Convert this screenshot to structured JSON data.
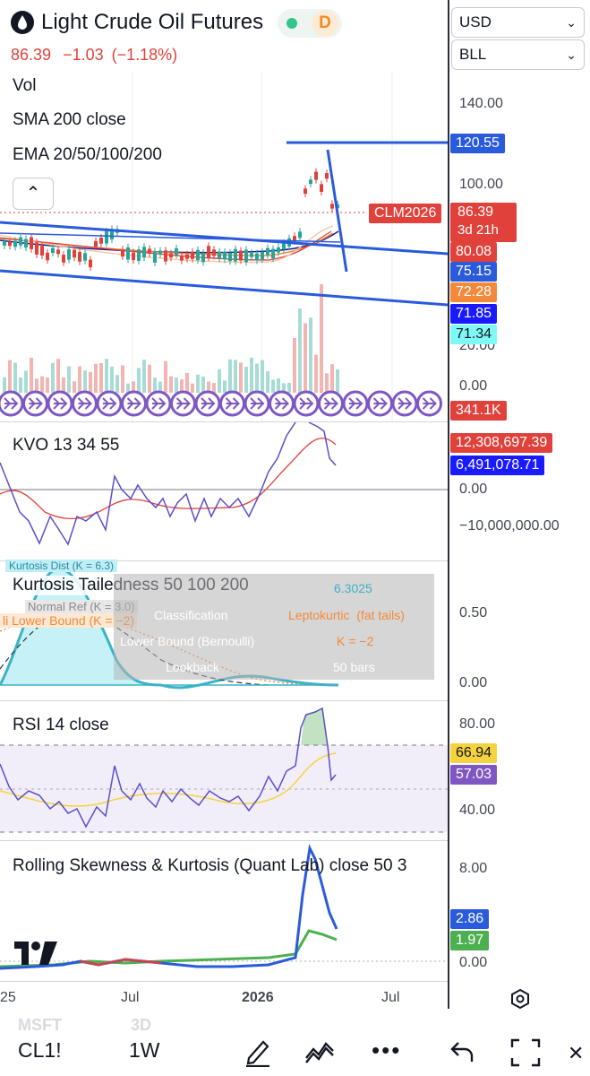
{
  "header": {
    "title": "Light Crude Oil Futures",
    "delay_badge": "D",
    "price": "86.39",
    "change": "−1.03",
    "change_pct": "(−1.18%)"
  },
  "currency_select": "USD",
  "unit_select": "BLL",
  "legends": {
    "vol": "Vol",
    "sma": "SMA 200 close",
    "ema": "EMA 20/50/100/200",
    "kvo": "KVO 13 34 55",
    "kurtosis": "Kurtosis Tailedness 50 100 200",
    "rsi": "RSI 14 close",
    "skew": "Rolling Skewness & Kurtosis (Quant Lab) close 50 3"
  },
  "price_ticks": [
    "140.00",
    "100.00",
    "20.00",
    "0.00"
  ],
  "price_tags": {
    "high": "120.55",
    "symbol": "CLM2026",
    "last": "86.39",
    "countdown": "3d 21h",
    "t1": "80.08",
    "t2": "75.15",
    "t3": "72.28",
    "t4": "71.85",
    "t5": "71.34",
    "vol": "341.1K"
  },
  "kvo": {
    "ticks": [
      "0.00",
      "−10,000,000.00"
    ],
    "tag1": "12,308,697.39",
    "tag2": "6,491,078.71"
  },
  "kurtosis": {
    "ticks": [
      "0.50",
      "0.00"
    ],
    "overlay_labels": {
      "dist": "Kurtosis Dist (K = 6.3)",
      "normal": "Normal Ref (K = 3.0)",
      "lower": "li Lower Bound (K = −2)"
    },
    "table": [
      {
        "label": "",
        "value": "6.3025"
      },
      {
        "label": "Classification",
        "value": "Leptokurtic  (fat tails)"
      },
      {
        "label": "Lower Bound (Bernoulli)",
        "value": "K = −2"
      },
      {
        "label": "Lookback",
        "value": "50 bars"
      }
    ]
  },
  "rsi": {
    "ticks": [
      "80.00",
      "40.00"
    ],
    "tag1": "66.94",
    "tag2": "57.03"
  },
  "skew": {
    "ticks": [
      "8.00",
      "0.00"
    ],
    "tag1": "2.86",
    "tag2": "1.97"
  },
  "x_axis": [
    "25",
    "Jul",
    "2026",
    "Jul"
  ],
  "ghost": {
    "sym": "MSFT",
    "tf": "3D"
  },
  "bottom_bar": {
    "symbol": "CL1!",
    "interval": "1W"
  },
  "colors": {
    "red": "#e0423b",
    "blue": "#2a5bdc",
    "orange": "#f3893a",
    "navy": "#1a1aff",
    "cyan": "#7ff9f5",
    "purple": "#7e57c2",
    "yellow": "#f5d33f",
    "green": "#4caf50"
  }
}
